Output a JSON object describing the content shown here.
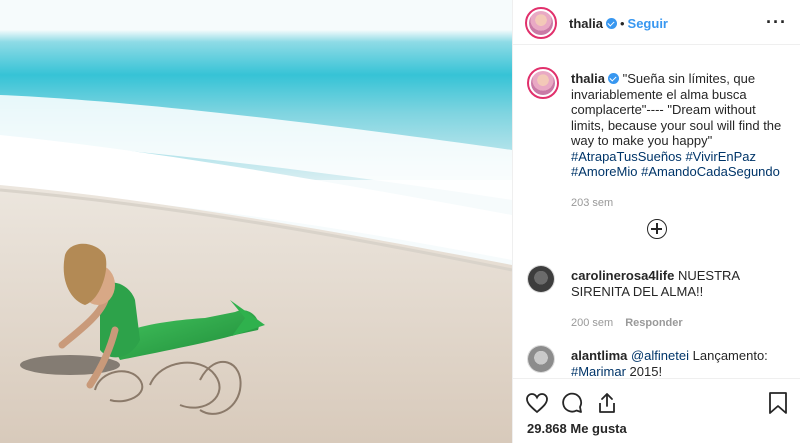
{
  "post": {
    "author": "thalia",
    "follow_label": "Seguir",
    "separator": "•",
    "more_label": "···",
    "likes_count": "29.868",
    "likes_label": "Me gusta",
    "load_more_label": "+"
  },
  "caption": {
    "username": "thalia",
    "text_1": "\"Sueña sin límites, que invariablemente el alma busca complacerte\"---- \"Dream without limits, because your soul will find the way to make you happy\"",
    "hashtags": [
      "#AtrapaTusSueños",
      "#VivirEnPaz",
      "#AmoreMio",
      "#AmandoCadaSegundo"
    ],
    "time": "203 sem"
  },
  "comments": [
    {
      "username": "carolinerosa4life",
      "text": "NUESTRA SIRENITA DEL ALMA!!",
      "time": "200 sem",
      "reply_label": "Responder"
    },
    {
      "username": "alantlima",
      "mention": "@alfinetei",
      "text": "Lançamento:",
      "hashtag": "#Marimar",
      "text_end": "2015!"
    }
  ],
  "icons": {
    "like": "heart-icon",
    "comment": "comment-icon",
    "share": "share-icon",
    "save": "bookmark-icon",
    "more": "more-options-icon",
    "load_more": "plus-circle-icon",
    "verified": "verified-badge-icon"
  },
  "colors": {
    "link_blue": "#3897f0",
    "hashtag": "#003569",
    "muted": "#999999",
    "story_ring": "#e1306c",
    "sea": "#4cc7d6",
    "sand": "#e6ddd3",
    "tail_green": "#2ea84a"
  }
}
